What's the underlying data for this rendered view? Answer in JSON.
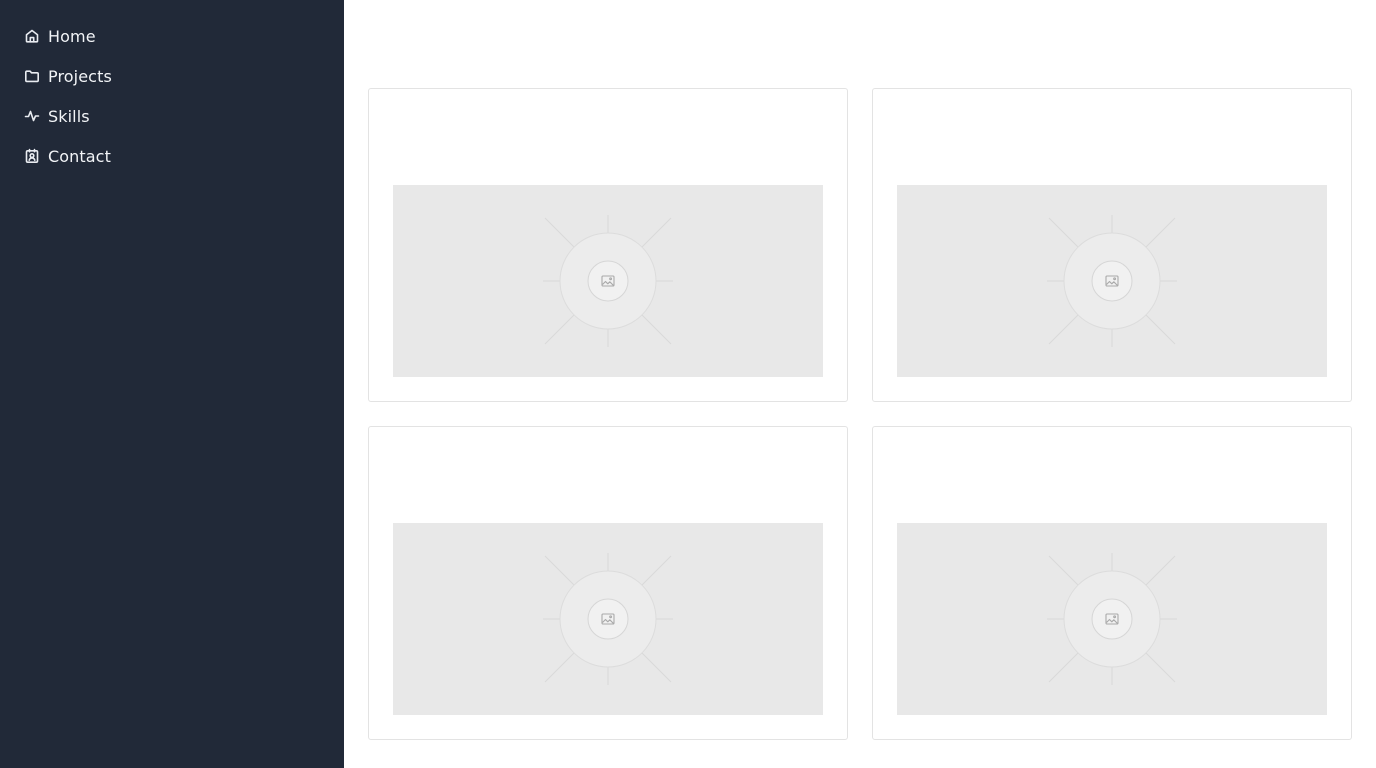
{
  "sidebar": {
    "items": [
      {
        "label": "Home",
        "icon": "home-icon"
      },
      {
        "label": "Projects",
        "icon": "folder-icon"
      },
      {
        "label": "Skills",
        "icon": "activity-icon"
      },
      {
        "label": "Contact",
        "icon": "contact-icon"
      }
    ]
  },
  "main": {
    "cards": [
      {
        "image_icon": "image-placeholder-icon"
      },
      {
        "image_icon": "image-placeholder-icon"
      },
      {
        "image_icon": "image-placeholder-icon"
      },
      {
        "image_icon": "image-placeholder-icon"
      }
    ]
  },
  "colors": {
    "sidebar_bg": "#212938",
    "sidebar_text": "#f2f4f7",
    "placeholder_bg": "#e8e8e8",
    "card_border": "#e3e3e3"
  }
}
